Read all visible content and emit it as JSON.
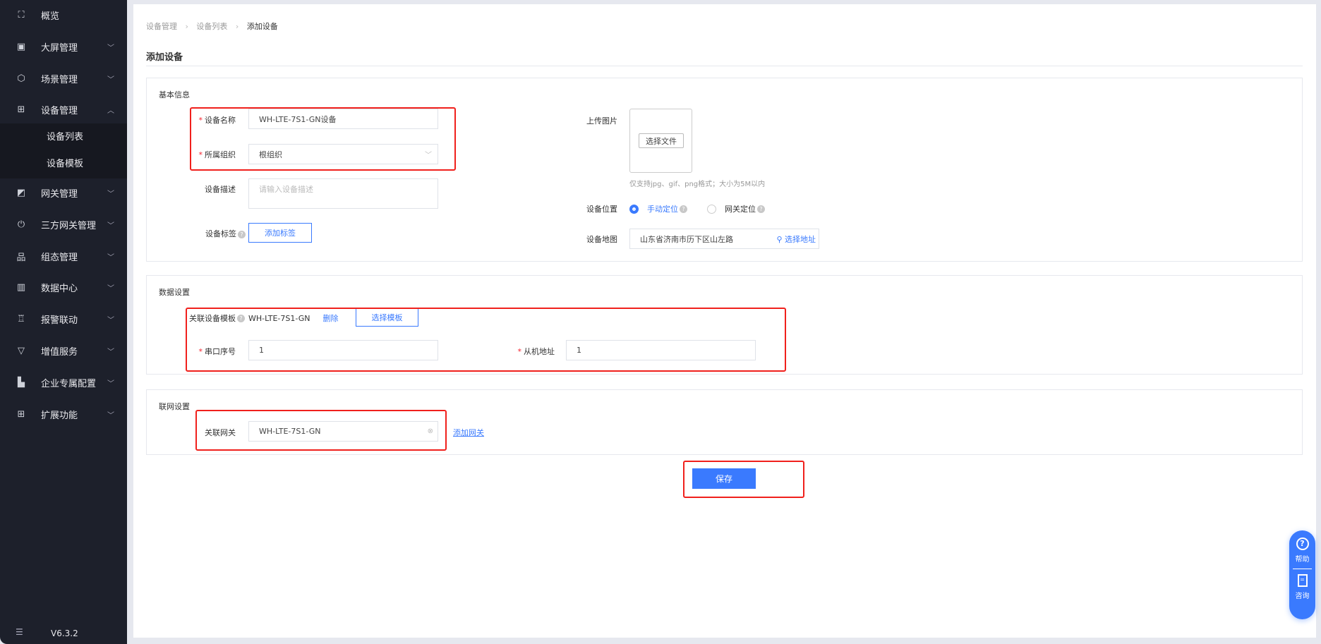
{
  "sidebar": {
    "items": [
      {
        "icon": "overview-icon",
        "glyph": "⛶",
        "label": "概览"
      },
      {
        "icon": "screen-icon",
        "glyph": "▣",
        "label": "大屏管理"
      },
      {
        "icon": "scene-icon",
        "glyph": "⬡",
        "label": "场景管理"
      },
      {
        "icon": "device-icon",
        "glyph": "⊞",
        "label": "设备管理",
        "expanded": true
      },
      {
        "icon": "gateway-icon",
        "glyph": "◩",
        "label": "网关管理"
      },
      {
        "icon": "third-party-gateway-icon",
        "glyph": "⏻",
        "label": "三方网关管理"
      },
      {
        "icon": "configuration-icon",
        "glyph": "品",
        "label": "组态管理"
      },
      {
        "icon": "data-center-icon",
        "glyph": "▥",
        "label": "数据中心"
      },
      {
        "icon": "alarm-icon",
        "glyph": "♖",
        "label": "报警联动"
      },
      {
        "icon": "value-added-icon",
        "glyph": "▽",
        "label": "增值服务"
      },
      {
        "icon": "enterprise-icon",
        "glyph": "▙",
        "label": "企业专属配置"
      },
      {
        "icon": "extension-icon",
        "glyph": "⊞",
        "label": "扩展功能"
      }
    ],
    "subitems": [
      "设备列表",
      "设备模板"
    ],
    "version": "V6.3.2"
  },
  "breadcrumb": [
    "设备管理",
    "设备列表",
    "添加设备"
  ],
  "page_title": "添加设备",
  "basic": {
    "title": "基本信息",
    "name_label": "设备名称",
    "name_value": "WH-LTE-7S1-GN设备",
    "org_label": "所属组织",
    "org_value": "根组织",
    "desc_label": "设备描述",
    "desc_placeholder": "请输入设备描述",
    "tag_label": "设备标签",
    "tag_button": "添加标签",
    "upload_label": "上传图片",
    "upload_button": "选择文件",
    "upload_hint": "仅支持jpg、gif、png格式；大小为5M以内",
    "position_label": "设备位置",
    "position_options": [
      "手动定位",
      "网关定位"
    ],
    "position_selected": "手动定位",
    "map_label": "设备地图",
    "map_value": "山东省济南市历下区山左路",
    "map_button": "选择地址"
  },
  "data": {
    "title": "数据设置",
    "template_label": "关联设备模板",
    "template_value": "WH-LTE-7S1-GN",
    "delete": "删除",
    "select_template": "选择模板",
    "serial_label": "串口序号",
    "serial_value": "1",
    "slave_label": "从机地址",
    "slave_value": "1"
  },
  "network": {
    "title": "联网设置",
    "gateway_label": "关联网关",
    "gateway_value": "WH-LTE-7S1-GN",
    "add_gateway": "添加网关"
  },
  "save": "保存",
  "float": {
    "help": "帮助",
    "consult": "咨询"
  },
  "colors": {
    "primary": "#3a7afe",
    "sidebar": "#1d202b",
    "highlight": "#f0201c"
  }
}
